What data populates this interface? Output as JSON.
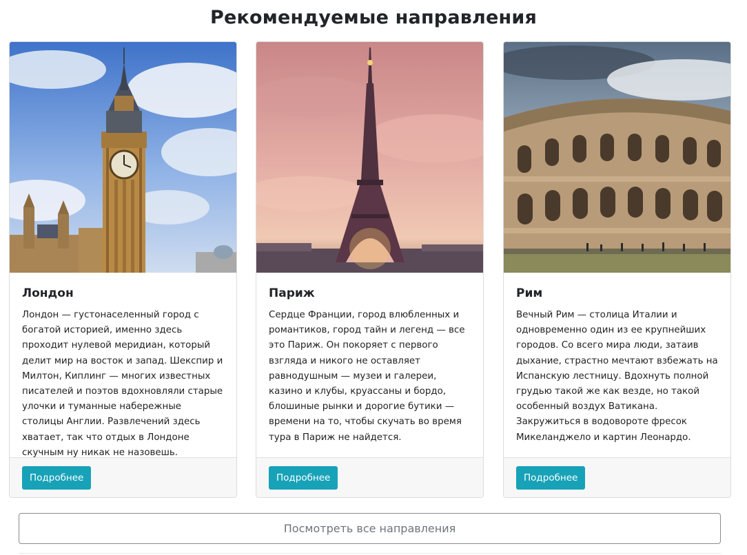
{
  "section": {
    "title": "Рекомендуемые направления"
  },
  "cards": [
    {
      "title": "Лондон",
      "text": "Лондон — густонаселенный город с богатой историей, именно здесь проходит нулевой меридиан, который делит мир на восток и запад. Шекспир и Милтон, Киплинг — многих известных писателей и поэтов вдохновляли старые улочки и туманные набережные столицы Англии. Развлечений здесь хватает, так что отдых в Лондоне скучным ну никак не назовешь.",
      "button": "Подробнее"
    },
    {
      "title": "Париж",
      "text": "Сердце Франции, город влюбленных и романтиков, город тайн и легенд — все это Париж. Он покоряет с первого взгляда и никого не оставляет равнодушным — музеи и галереи, казино и клубы, круассаны и бордо, блошиные рынки и дорогие бутики — времени на то, чтобы скучать во время тура в Париж не найдется.",
      "button": "Подробнее"
    },
    {
      "title": "Рим",
      "text": "Вечный Рим — столица Италии и одновременно один из ее крупнейших городов. Со всего мира люди, затаив дыхание, страстно мечтают взбежать на Испанскую лестницу. Вдохнуть полной грудью такой же как везде, но такой особенный воздух Ватикана. Закружиться в водовороте фресок Микеланджело и картин Леонардо.",
      "button": "Подробнее"
    }
  ],
  "footer": {
    "all_button": "Посмотреть все направления"
  },
  "colors": {
    "button_bg": "#17a2b8",
    "footer_bg": "#f7f7f7",
    "border": "#dcdcdc"
  },
  "icons": {
    "card_1_image": "big-ben-photo",
    "card_2_image": "eiffel-tower-photo",
    "card_3_image": "colosseum-photo"
  }
}
